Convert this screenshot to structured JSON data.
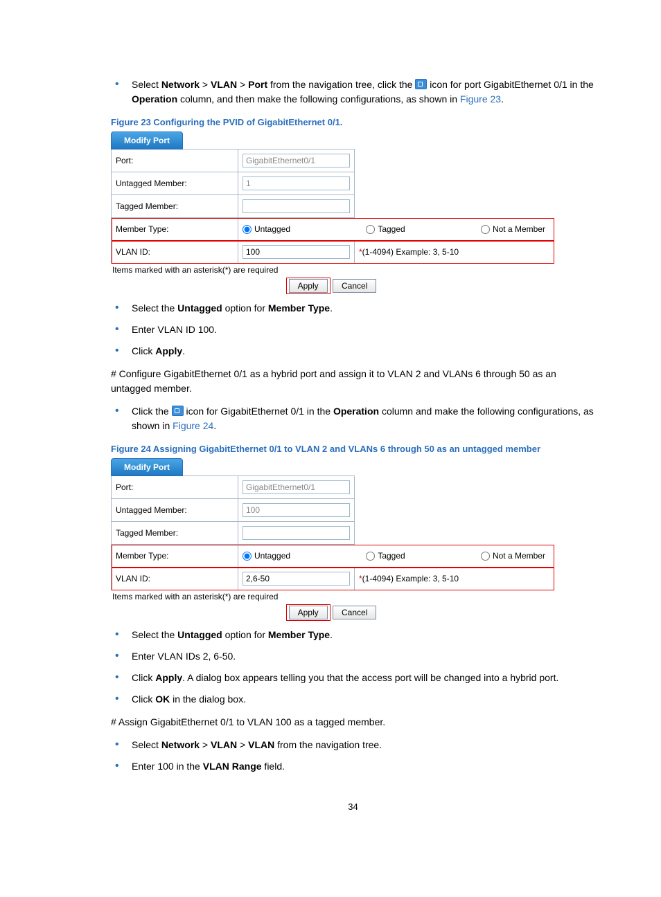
{
  "intro_bullet_a": "Select ",
  "intro_bullet_b": " > ",
  "intro_bullet_nav1": "Network",
  "intro_bullet_nav2": "VLAN",
  "intro_bullet_nav3": "Port",
  "intro_bullet_c": " from the navigation tree, click the ",
  "intro_bullet_d": " icon for port GigabitEthernet 0/1 in the ",
  "intro_bullet_op": "Operation",
  "intro_bullet_e": " column, and then make the following configurations, as shown in ",
  "intro_bullet_link1": "Figure 23",
  "intro_bullet_f": ".",
  "fig23_caption": "Figure 23 Configuring the PVID of GigabitEthernet 0/1.",
  "fig24_caption": "Figure 24 Assigning GigabitEthernet 0/1 to VLAN 2 and VLANs 6 through 50 as an untagged member",
  "panel": {
    "tab": "Modify Port",
    "labels": {
      "port": "Port:",
      "untagged": "Untagged Member:",
      "tagged": "Tagged Member:",
      "membertype": "Member Type:",
      "vlanid": "VLAN ID:"
    },
    "radios": {
      "untagged": "Untagged",
      "tagged": "Tagged",
      "notmember": "Not a Member"
    },
    "hint": "(1-4094) Example: 3, 5-10",
    "note": "Items marked with an asterisk(*) are required",
    "apply": "Apply",
    "cancel": "Cancel"
  },
  "fig23_vals": {
    "port": "GigabitEthernet0/1",
    "untagged": "1",
    "tagged": "",
    "vlanid": "100"
  },
  "fig24_vals": {
    "port": "GigabitEthernet0/1",
    "untagged": "100",
    "tagged": "",
    "vlanid": "2,6-50"
  },
  "after23": {
    "b1a": "Select the ",
    "b1b": "Untagged",
    "b1c": " option for ",
    "b1d": "Member Type",
    "b1e": ".",
    "b2": "Enter VLAN ID 100.",
    "b3a": "Click ",
    "b3b": "Apply",
    "b3c": "."
  },
  "para1": "# Configure GigabitEthernet 0/1 as a hybrid port and assign it to VLAN 2 and VLANs 6 through 50 as an untagged member.",
  "b_click_a": "Click the ",
  "b_click_b": " icon for GigabitEthernet 0/1 in the ",
  "b_click_op": "Operation",
  "b_click_c": " column and make the following configurations, as shown in ",
  "b_click_link": "Figure 24",
  "b_click_d": ".",
  "after24": {
    "b1a": "Select the ",
    "b1b": "Untagged",
    "b1c": " option for ",
    "b1d": "Member Type",
    "b1e": ".",
    "b2": "Enter VLAN IDs 2, 6-50.",
    "b3a": "Click ",
    "b3b": "Apply",
    "b3c": ". A dialog box appears telling you that the access port will be changed into a hybrid port.",
    "b4a": "Click ",
    "b4b": "OK",
    "b4c": " in the dialog box."
  },
  "para2": "# Assign GigabitEthernet 0/1 to VLAN 100 as a tagged member.",
  "b5a": "Select ",
  "b5n1": "Network",
  "b5s": " > ",
  "b5n2": "VLAN",
  "b5n3": "VLAN",
  "b5b": " from the navigation tree.",
  "b6a": "Enter 100 in the ",
  "b6b": "VLAN Range",
  "b6c": " field.",
  "page_number": "34"
}
